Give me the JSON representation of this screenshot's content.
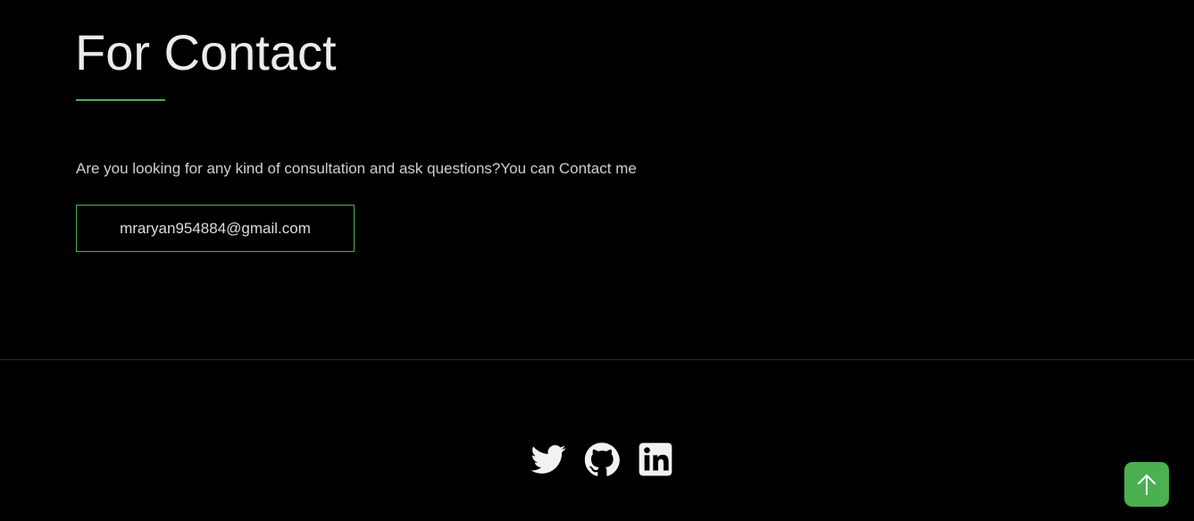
{
  "contact": {
    "title": "For Contact",
    "description": "Are you looking for any kind of consultation and ask questions?You can Contact me",
    "email": "mraryan954884@gmail.com"
  },
  "footer": {
    "social": [
      {
        "name": "twitter",
        "icon": "twitter-icon"
      },
      {
        "name": "github",
        "icon": "github-icon"
      },
      {
        "name": "linkedin",
        "icon": "linkedin-icon"
      }
    ]
  },
  "scroll_top": {
    "icon": "arrow-up-icon"
  },
  "colors": {
    "background": "#000000",
    "accent": "#4caf50",
    "text": "#cfcfcf",
    "icon": "#f2f2f2"
  }
}
